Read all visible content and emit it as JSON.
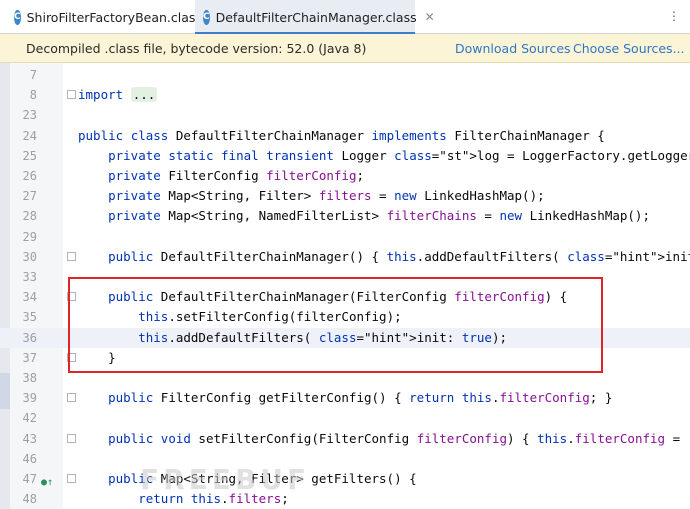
{
  "tabs": [
    {
      "label": "ShiroFilterFactoryBean.class",
      "icon": "class-icon"
    },
    {
      "label": "DefaultFilterChainManager.class",
      "icon": "class-icon"
    }
  ],
  "tab_menu": "⋮",
  "banner": {
    "message": "Decompiled .class file, bytecode version: 52.0 (Java 8)",
    "download": "Download Sources",
    "choose": "Choose Sources..."
  },
  "lines": [
    {
      "n": "7",
      "t": ""
    },
    {
      "n": "8",
      "t": "import ..."
    },
    {
      "n": "23",
      "t": ""
    },
    {
      "n": "24",
      "t": "public class DefaultFilterChainManager implements FilterChainManager {"
    },
    {
      "n": "25",
      "t": "    private static final transient Logger log = LoggerFactory.getLogger(DefaultFil"
    },
    {
      "n": "26",
      "t": "    private FilterConfig filterConfig;"
    },
    {
      "n": "27",
      "t": "    private Map<String, Filter> filters = new LinkedHashMap();"
    },
    {
      "n": "28",
      "t": "    private Map<String, NamedFilterList> filterChains = new LinkedHashMap();"
    },
    {
      "n": "29",
      "t": ""
    },
    {
      "n": "30",
      "t": "    public DefaultFilterChainManager() { this.addDefaultFilters( init: false); }"
    },
    {
      "n": "33",
      "t": ""
    },
    {
      "n": "34",
      "t": "    public DefaultFilterChainManager(FilterConfig filterConfig) {"
    },
    {
      "n": "35",
      "t": "        this.setFilterConfig(filterConfig);"
    },
    {
      "n": "36",
      "t": "        this.addDefaultFilters( init: true);"
    },
    {
      "n": "37",
      "t": "    }"
    },
    {
      "n": "38",
      "t": ""
    },
    {
      "n": "39",
      "t": "    public FilterConfig getFilterConfig() { return this.filterConfig; }"
    },
    {
      "n": "42",
      "t": ""
    },
    {
      "n": "43",
      "t": "    public void setFilterConfig(FilterConfig filterConfig) { this.filterConfig = "
    },
    {
      "n": "46",
      "t": ""
    },
    {
      "n": "47",
      "t": "    public Map<String, Filter> getFilters() {"
    },
    {
      "n": "48",
      "t": "        return this.filters;"
    }
  ],
  "watermark": "FREEBUF",
  "colors": {
    "keyword": "#0033b3",
    "field": "#871094",
    "highlight_box": "#e0242a"
  }
}
